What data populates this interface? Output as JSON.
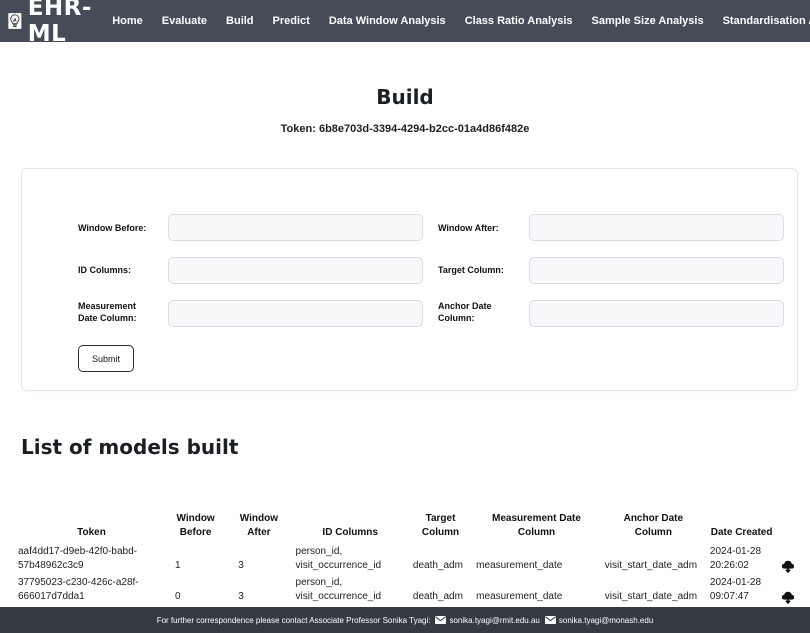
{
  "app": {
    "brand": "EHR-ML",
    "nav": [
      "Home",
      "Evaluate",
      "Build",
      "Predict",
      "Data Window Analysis",
      "Class Ratio Analysis",
      "Sample Size Analysis",
      "Standardisation Analysis"
    ]
  },
  "header": {
    "title": "Build",
    "token": "Token: 6b8e703d-3394-4294-b2cc-01a4d86f482e"
  },
  "form": {
    "window_before_label": "Window Before:",
    "window_before_value": "",
    "window_after_label": "Window After:",
    "window_after_value": "",
    "id_columns_label": "ID Columns:",
    "id_columns_value": "",
    "target_column_label": "Target Column:",
    "target_column_value": "",
    "measurement_date_label": "Measurement Date Column:",
    "measurement_date_value": "",
    "anchor_date_label": "Anchor Date Column:",
    "anchor_date_value": "",
    "submit_label": "Submit"
  },
  "models": {
    "title": "List of models built",
    "columns": [
      "Token",
      "Window Before",
      "Window After",
      "ID Columns",
      "Target Column",
      "Measurement Date Column",
      "Anchor Date Column",
      "Date Created",
      ""
    ],
    "rows": [
      {
        "token": "aaf4dd17-d9eb-42f0-babd-57b48962c3c9",
        "window_before": "1",
        "window_after": "3",
        "id_columns": "person_id, visit_occurrence_id",
        "target_column": "death_adm",
        "measurement_date_column": "measurement_date",
        "anchor_date_column": "visit_start_date_adm",
        "date_created": "2024-01-28 20:26:02",
        "action_icon": "cloud-download-icon"
      },
      {
        "token": "37795023-c230-426c-a28f-666017d7dda1",
        "window_before": "0",
        "window_after": "3",
        "id_columns": "person_id, visit_occurrence_id",
        "target_column": "death_adm",
        "measurement_date_column": "measurement_date",
        "anchor_date_column": "visit_start_date_adm",
        "date_created": "2024-01-28 09:07:47",
        "action_icon": "cloud-download-icon"
      }
    ]
  },
  "footer": {
    "text": "For further correspondence please contact Associate Professor Sonika Tyagi:",
    "email1": "sonika.tyagi@rmit.edu.au",
    "email2": "sonika.tyagi@monash.edu"
  },
  "colors": {
    "navbar": "#464c57",
    "footer": "#343a41"
  }
}
